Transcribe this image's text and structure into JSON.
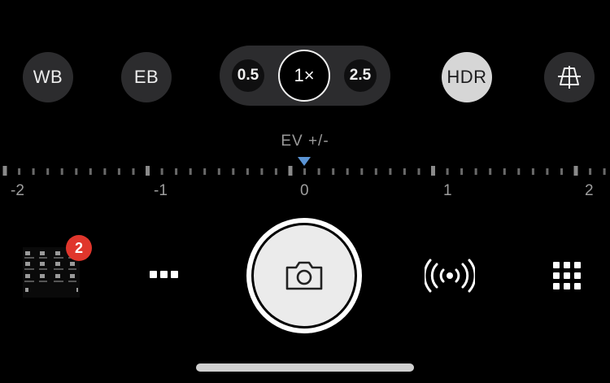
{
  "top_controls": {
    "wb_label": "WB",
    "eb_label": "EB",
    "hdr_label": "HDR",
    "grid_icon": "crop-grid-icon"
  },
  "zoom": {
    "options": [
      "0.5",
      "1×",
      "2.5"
    ],
    "selected": "1×"
  },
  "exposure": {
    "title": "EV +/-",
    "ticks": [
      "-2",
      "-1",
      "0",
      "1",
      "2"
    ],
    "current_value": 0,
    "marker_color": "#5b95d6"
  },
  "bottom": {
    "badge_count": "2",
    "more_icon": "more-dots-icon",
    "shutter_icon": "camera-icon",
    "broadcast_icon": "broadcast-icon",
    "grid_icon": "apps-grid-icon"
  },
  "colors": {
    "background": "#000000",
    "button": "#2c2c2e",
    "hdr_active": "#d6d6d6",
    "badge": "#e0362c"
  }
}
